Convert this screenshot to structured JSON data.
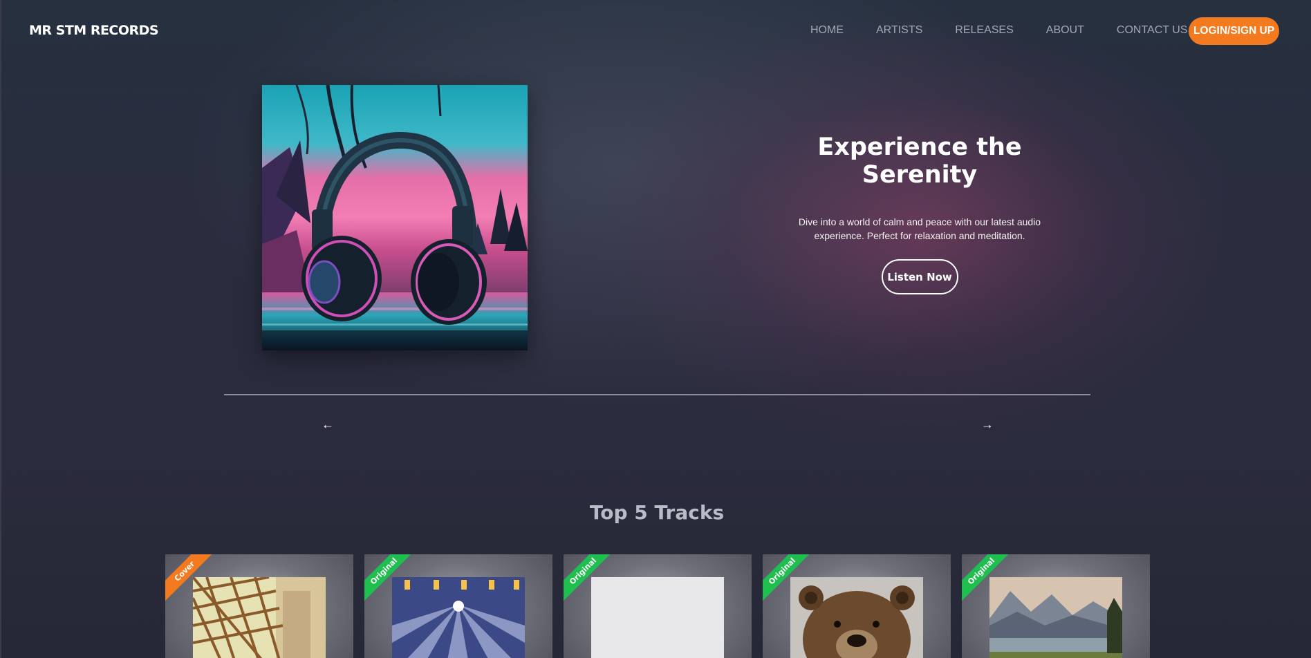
{
  "header": {
    "logo": "MR STM RECORDS",
    "nav": [
      "HOME",
      "ARTISTS",
      "RELEASES",
      "ABOUT",
      "CONTACT US"
    ],
    "login_label": "LOGIN/SIGN UP"
  },
  "hero": {
    "title": "Experience the Serenity",
    "description": "Dive into a world of calm and peace with our latest audio experience. Perfect for relaxation and meditation.",
    "button_label": "Listen Now",
    "prev_arrow": "←",
    "next_arrow": "→"
  },
  "tracks": {
    "title": "Top 5 Tracks",
    "items": [
      {
        "tag": "Cover"
      },
      {
        "tag": "Original"
      },
      {
        "tag": "Original"
      },
      {
        "tag": "Original"
      },
      {
        "tag": "Original"
      }
    ]
  },
  "colors": {
    "accent": "#f47a20",
    "original_tag": "#1fbf4f",
    "cover_tag": "#f47a20"
  }
}
